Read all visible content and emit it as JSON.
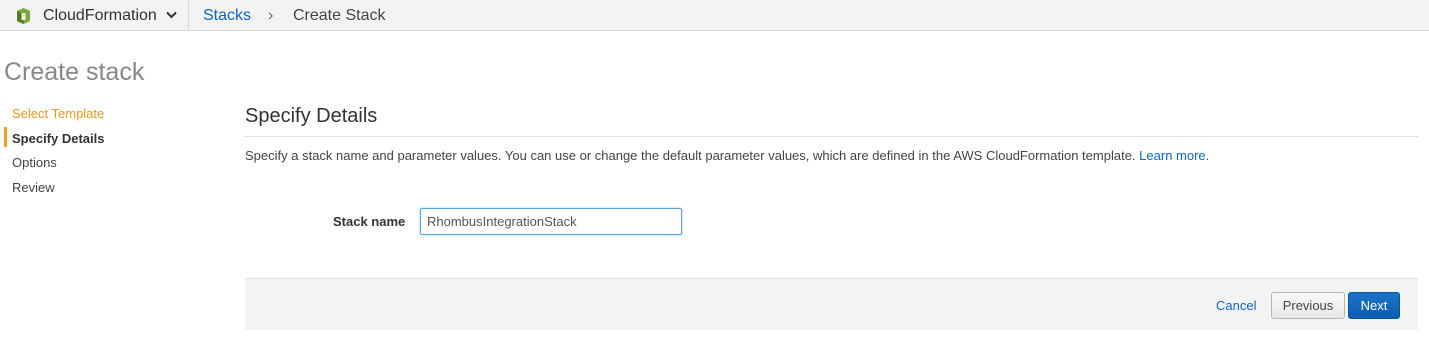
{
  "breadcrumb": {
    "service": "CloudFormation",
    "parent": "Stacks",
    "separator": "›",
    "current": "Create Stack"
  },
  "page": {
    "title": "Create stack"
  },
  "steps": [
    {
      "label": "Select Template",
      "state": "completed"
    },
    {
      "label": "Specify Details",
      "state": "active"
    },
    {
      "label": "Options",
      "state": "pending"
    },
    {
      "label": "Review",
      "state": "pending"
    }
  ],
  "section": {
    "title": "Specify Details",
    "description": "Specify a stack name and parameter values. You can use or change the default parameter values, which are defined in the AWS CloudFormation template.",
    "learn_more": "Learn more."
  },
  "form": {
    "stack_name_label": "Stack name",
    "stack_name_value": "RhombusIntegrationStack"
  },
  "actions": {
    "cancel": "Cancel",
    "previous": "Previous",
    "next": "Next"
  },
  "colors": {
    "link": "#1066bb",
    "step_completed": "#e59a1f",
    "primary_button": "#1166bb",
    "service_icon": "#6b9a2e"
  },
  "icons": {
    "service": "cloudformation-icon",
    "dropdown": "chevron-down-icon"
  }
}
